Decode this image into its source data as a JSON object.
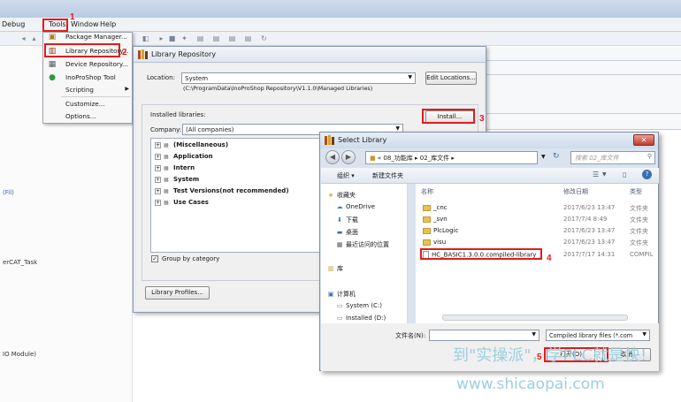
{
  "menubar": {
    "items": [
      "Debug",
      "Tools",
      "Window",
      "Help"
    ]
  },
  "left_panel": {
    "lines": [
      "(Fil)",
      "erCAT_Task",
      "IO Module)"
    ]
  },
  "tools_menu": {
    "items": [
      {
        "label": "Package Manager...",
        "icon": "package-icon"
      },
      {
        "label": "Library Repository...",
        "icon": "library-icon"
      },
      {
        "label": "Device Repository...",
        "icon": "device-icon"
      },
      {
        "label": "InoProShop Tool",
        "icon": "tool-icon"
      },
      {
        "label": "Scripting",
        "icon": "",
        "submenu": true
      },
      {
        "label": "Customize...",
        "icon": ""
      },
      {
        "label": "Options...",
        "icon": ""
      }
    ]
  },
  "annotations": {
    "n1": "1",
    "n2": "2",
    "n3": "3",
    "n4": "4",
    "n5": "5"
  },
  "library_repository": {
    "title": "Library Repository",
    "location_label": "Location:",
    "location_value": "System",
    "location_path": "(C:\\ProgramData\\InoProShop Repository\\V1.1.0\\Managed Libraries)",
    "edit_locations": "Edit Locations...",
    "installed_label": "Installed libraries:",
    "install_button": "Install...",
    "company_label": "Company:",
    "company_value": "(All companies)",
    "tree": [
      "(Miscellaneous)",
      "Application",
      "Intern",
      "System",
      "Test Versions(not recommended)",
      "Use Cases"
    ],
    "group_by": "Group by category",
    "library_profiles": "Library Profiles..."
  },
  "select_library": {
    "title": "Select Library",
    "breadcrumb": "«  08_功能库  ▸  02_库文件  ▸",
    "search_placeholder": "搜索 02_库文件",
    "organize": "组织 ▾",
    "new_folder": "新建文件夹",
    "nav": [
      {
        "label": "收藏夹",
        "icon": "star-icon"
      },
      {
        "label": "OneDrive",
        "icon": "cloud-icon"
      },
      {
        "label": "下载",
        "icon": "download-icon"
      },
      {
        "label": "桌面",
        "icon": "desktop-icon"
      },
      {
        "label": "最近访问的位置",
        "icon": "recent-icon"
      },
      {
        "label": "库",
        "icon": "library-folder-icon"
      },
      {
        "label": "计算机",
        "icon": "computer-icon"
      },
      {
        "label": "System (C:)",
        "icon": "drive-icon"
      },
      {
        "label": "Installed (D:)",
        "icon": "drive-icon"
      }
    ],
    "columns": [
      "名称",
      "修改日期",
      "类型"
    ],
    "files": [
      {
        "name": "_cnc",
        "date": "2017/6/23 13:47",
        "type": "文件夹",
        "folder": true
      },
      {
        "name": "_svn",
        "date": "2017/7/4 8:49",
        "type": "文件夹",
        "folder": true
      },
      {
        "name": "PlcLogic",
        "date": "2017/6/23 13:47",
        "type": "文件夹",
        "folder": true
      },
      {
        "name": "visu",
        "date": "2017/6/23 13:47",
        "type": "文件夹",
        "folder": true
      },
      {
        "name": "HC_BASIC1.3.0.0.compiled-library",
        "date": "2017/7/17 14:31",
        "type": "COMPIL",
        "folder": false
      }
    ],
    "filename_label": "文件名(N):",
    "filename_value": "",
    "filter_value": "Compiled library files (*.com",
    "open_button": "打开(O)",
    "cancel_button": "取消"
  },
  "watermark": {
    "line1": "到\"实操派\"，学PLC就是快!",
    "line2": "www.shicaopai.com"
  }
}
